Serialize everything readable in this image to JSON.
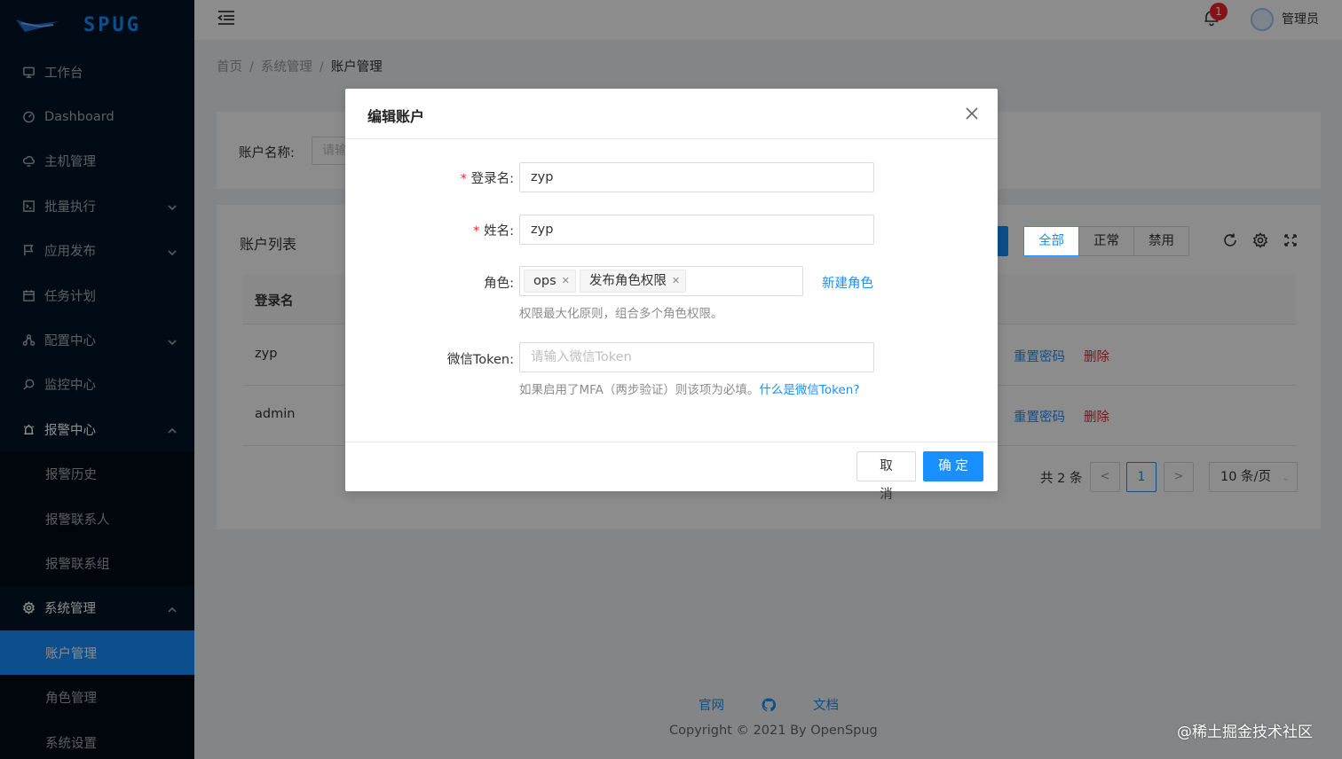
{
  "brand": {
    "name": "SPUG",
    "color": "#1890ff"
  },
  "sidebar": {
    "items": [
      {
        "label": "工作台",
        "icon": "desktop-icon",
        "arrow": ""
      },
      {
        "label": "Dashboard",
        "icon": "dashboard-icon",
        "arrow": ""
      },
      {
        "label": "主机管理",
        "icon": "cloud-server-icon",
        "arrow": ""
      },
      {
        "label": "批量执行",
        "icon": "code-icon",
        "arrow": "down"
      },
      {
        "label": "应用发布",
        "icon": "flag-icon",
        "arrow": "down"
      },
      {
        "label": "任务计划",
        "icon": "schedule-icon",
        "arrow": ""
      },
      {
        "label": "配置中心",
        "icon": "deployment-icon",
        "arrow": "down"
      },
      {
        "label": "监控中心",
        "icon": "monitor-icon",
        "arrow": ""
      },
      {
        "label": "报警中心",
        "icon": "alert-icon",
        "arrow": "up"
      },
      {
        "label": "报警历史",
        "sub": true
      },
      {
        "label": "报警联系人",
        "sub": true
      },
      {
        "label": "报警联系组",
        "sub": true
      },
      {
        "label": "系统管理",
        "icon": "setting-icon",
        "arrow": "up"
      },
      {
        "label": "账户管理",
        "sub": true,
        "active": true
      },
      {
        "label": "角色管理",
        "sub": true
      },
      {
        "label": "系统设置",
        "sub": true
      }
    ]
  },
  "header": {
    "notification_count": "1",
    "user_name": "管理员"
  },
  "breadcrumb": {
    "home": "首页",
    "section": "系统管理",
    "current": "账户管理"
  },
  "search": {
    "label": "账户名称:",
    "placeholder": "请输"
  },
  "list": {
    "title": "账户列表",
    "filters": {
      "all": "全部",
      "normal": "正常",
      "disabled": "禁用"
    },
    "columns": {
      "login": "登录名"
    },
    "rows": [
      {
        "login": "zyp",
        "reset": "重置密码",
        "delete": "删除"
      },
      {
        "login": "admin",
        "reset": "重置密码",
        "delete": "删除"
      }
    ],
    "pagination": {
      "total": "共 2 条",
      "prev": "<",
      "current": "1",
      "next": ">",
      "page_size": "10 条/页"
    }
  },
  "footer": {
    "site": "官网",
    "docs": "文档",
    "copyright": "Copyright © 2021 By OpenSpug"
  },
  "watermark": "@稀土掘金技术社区",
  "modal": {
    "title": "编辑账户",
    "fields": {
      "login": {
        "label": "登录名:",
        "value": "zyp"
      },
      "name": {
        "label": "姓名:",
        "value": "zyp"
      },
      "role": {
        "label": "角色:",
        "tags": [
          "ops",
          "发布角色权限"
        ],
        "new_role": "新建角色",
        "help": "权限最大化原则，组合多个角色权限。"
      },
      "wx_token": {
        "label": "微信Token:",
        "placeholder": "请输入微信Token",
        "help": "如果启用了MFA（两步验证）则该项为必填。",
        "help_link": "什么是微信Token?"
      }
    },
    "cancel": "取 消",
    "ok": "确 定"
  }
}
